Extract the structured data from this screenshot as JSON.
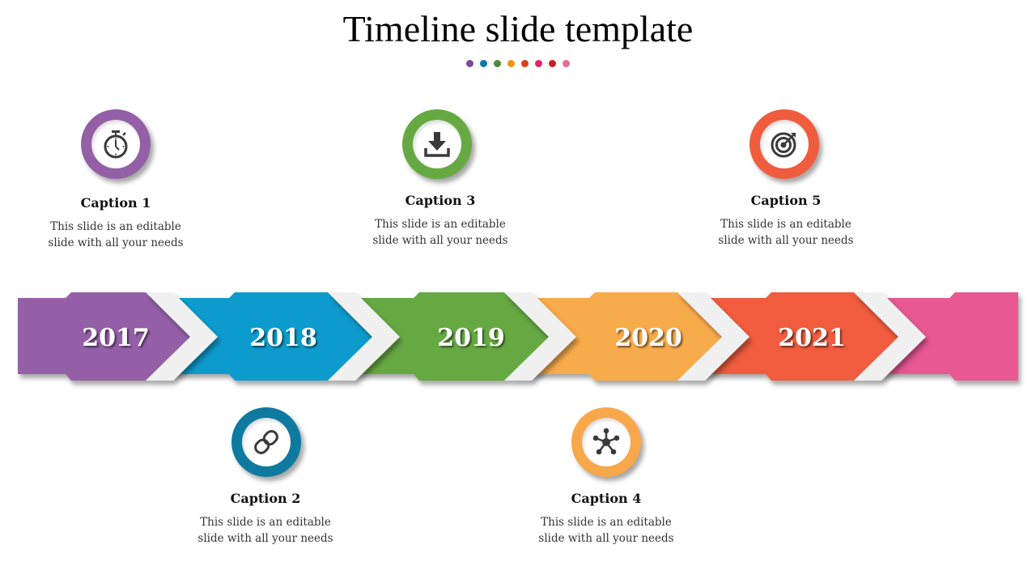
{
  "title": "Timeline slide template",
  "accent_dots": [
    "#7b4b94",
    "#0e79a4",
    "#4e8a3a",
    "#f39512",
    "#de3f16",
    "#e0236e",
    "#c42128",
    "#f06898"
  ],
  "timeline": [
    {
      "year": "2017",
      "color": "#945fa7",
      "shade": "#6e3f80"
    },
    {
      "year": "2018",
      "color": "#0d9bcd",
      "shade": "#077199"
    },
    {
      "year": "2019",
      "color": "#66a942",
      "shade": "#467e2a"
    },
    {
      "year": "2020",
      "color": "#f8ab4b",
      "shade": "#c07a22"
    },
    {
      "year": "2021",
      "color": "#f05c3e",
      "shade": "#b53a22"
    },
    {
      "year": "",
      "color": "#e85993",
      "shade": "#b53a6b"
    }
  ],
  "captions": [
    {
      "title": "Caption 1",
      "text_line1": "This slide is an editable",
      "text_line2": "slide with all your needs",
      "icon": "stopwatch-icon",
      "ring_color": "#945fa7"
    },
    {
      "title": "Caption 2",
      "text_line1": "This slide is an editable",
      "text_line2": "slide with all your needs",
      "icon": "link-icon",
      "ring_color": "#0e7aa0"
    },
    {
      "title": "Caption 3",
      "text_line1": "This slide is an editable",
      "text_line2": "slide with all your needs",
      "icon": "download-icon",
      "ring_color": "#66a942"
    },
    {
      "title": "Caption 4",
      "text_line1": "This slide is an editable",
      "text_line2": "slide with all your needs",
      "icon": "network-icon",
      "ring_color": "#f8a84a"
    },
    {
      "title": "Caption 5",
      "text_line1": "This slide is an editable",
      "text_line2": "slide with all your needs",
      "icon": "target-icon",
      "ring_color": "#f05c3e"
    }
  ]
}
